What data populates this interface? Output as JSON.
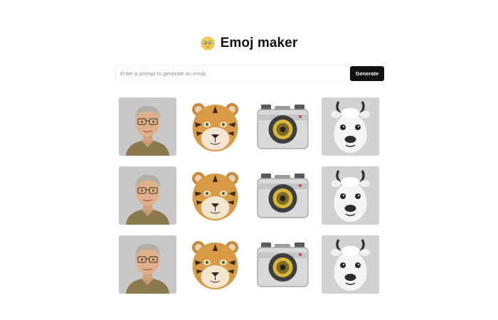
{
  "header": {
    "title": "Emoj maker",
    "logo_icon": "emoji-face-icon"
  },
  "prompt": {
    "placeholder": "Enter a prompt to generate an emoji",
    "value": "",
    "generate_label": "Generate"
  },
  "colors": {
    "button_bg": "#111111",
    "button_text": "#ffffff",
    "title_text": "#111111",
    "placeholder_text": "#8d8d8d"
  },
  "grid": {
    "rows": [
      [
        "person-emoji",
        "tiger-emoji",
        "camera-emoji",
        "llama-emoji"
      ],
      [
        "person-emoji",
        "tiger-emoji",
        "camera-emoji",
        "llama-emoji"
      ],
      [
        "person-emoji",
        "tiger-emoji",
        "camera-emoji",
        "llama-emoji"
      ]
    ]
  }
}
